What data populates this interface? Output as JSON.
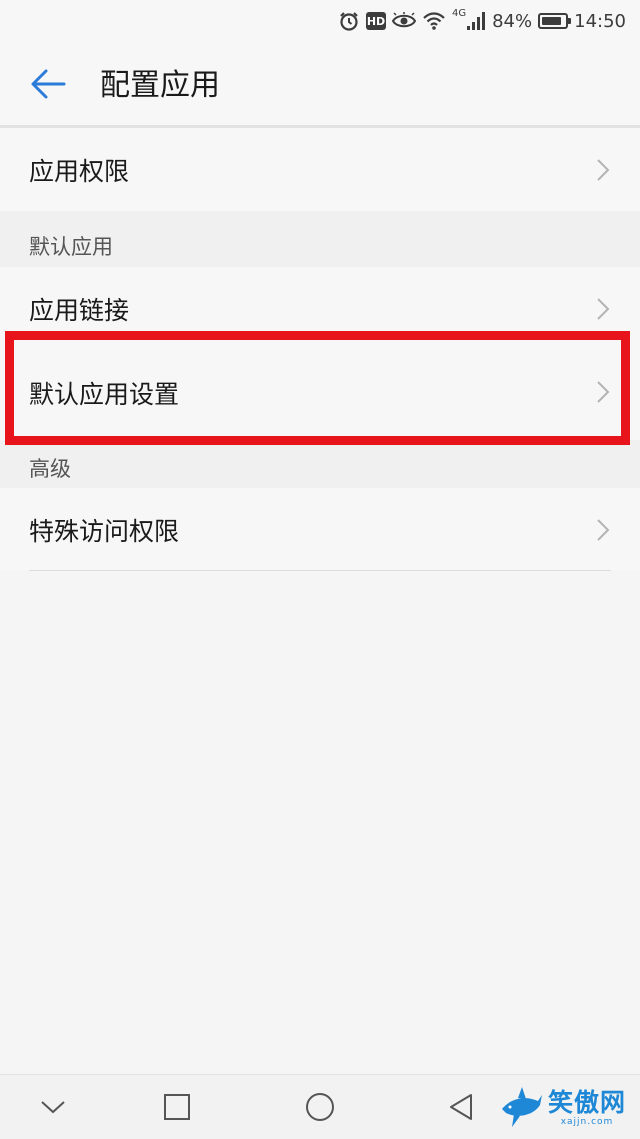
{
  "status_bar": {
    "battery_text": "84%",
    "battery_level": 0.84,
    "network_label": "4G",
    "hd_label": "HD",
    "time": "14:50"
  },
  "header": {
    "title": "配置应用"
  },
  "rows": {
    "app_permissions": "应用权限",
    "app_links": "应用链接",
    "default_app_settings": "默认应用设置",
    "special_access": "特殊访问权限"
  },
  "sections": {
    "default_apps": "默认应用",
    "advanced": "高级"
  },
  "watermark": {
    "main": "笑傲网",
    "sub": "xajjn.com"
  },
  "colors": {
    "accent": "#2b7bd9",
    "highlight": "#e8141c",
    "watermark": "#1e88d6"
  }
}
